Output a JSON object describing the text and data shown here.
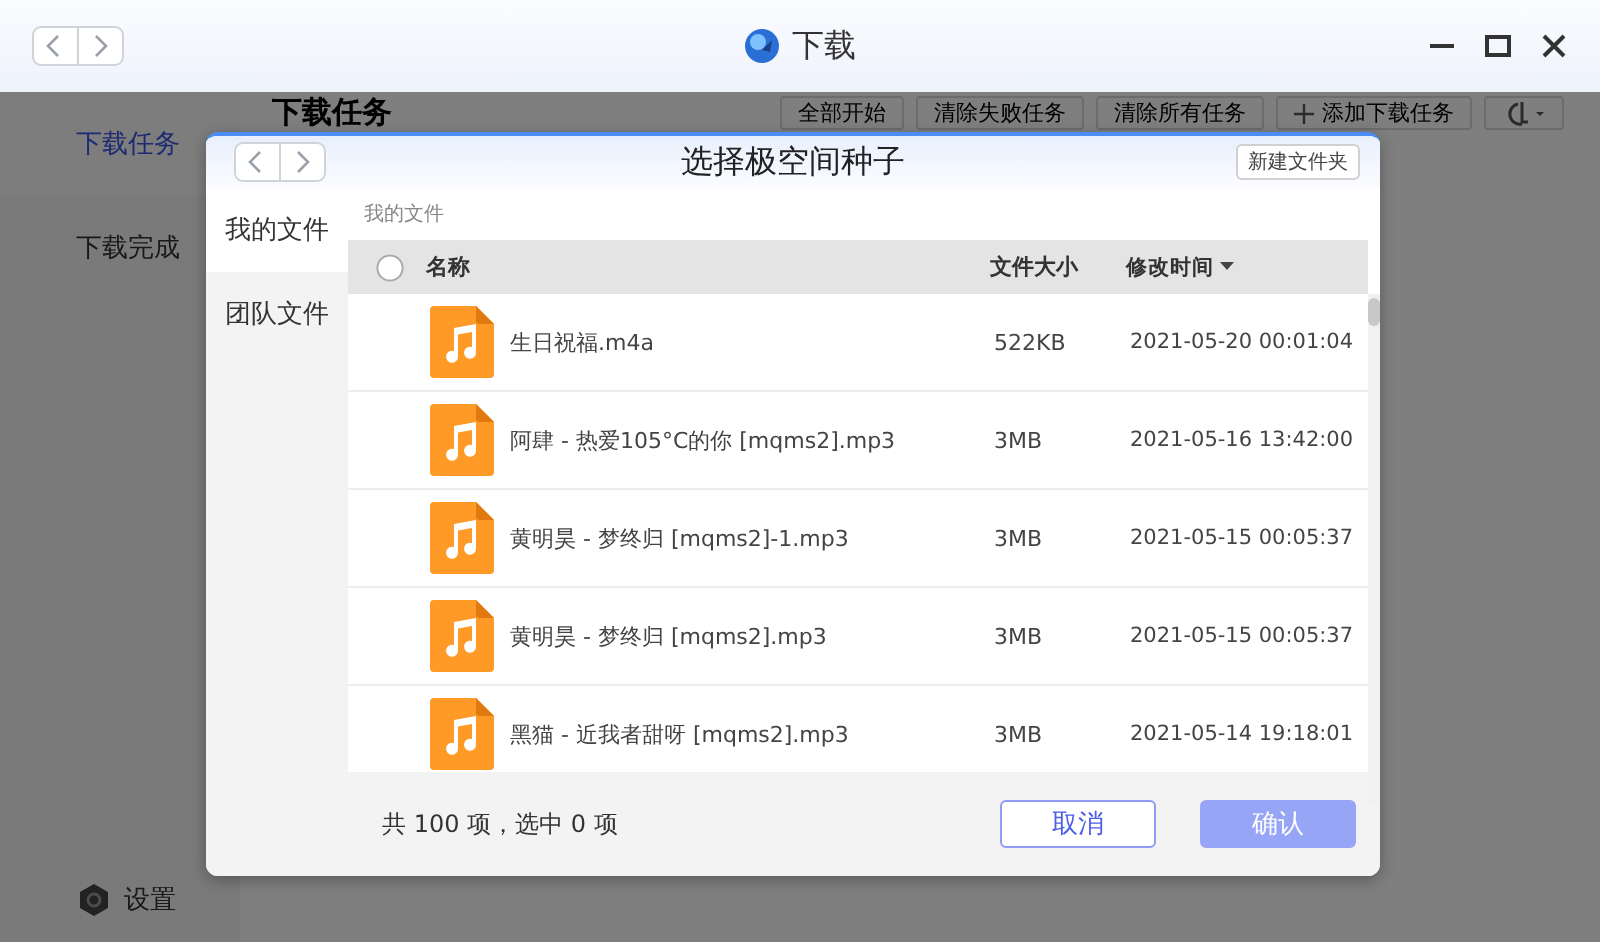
{
  "window": {
    "title": "下载"
  },
  "sidebar": {
    "items": [
      {
        "label": "下载任务",
        "selected": true
      },
      {
        "label": "下载完成",
        "selected": false
      }
    ],
    "settings": "设置"
  },
  "main": {
    "heading": "下载任务",
    "toolbar": [
      "全部开始",
      "清除失败任务",
      "清除所有任务"
    ],
    "add_button": "添加下载任务"
  },
  "dialog": {
    "title": "选择极空间种子",
    "new_folder": "新建文件夹",
    "tabs": [
      {
        "label": "我的文件",
        "selected": true
      },
      {
        "label": "团队文件",
        "selected": false
      }
    ],
    "breadcrumb": "我的文件",
    "select_all": {
      "checked": false
    },
    "columns": {
      "name": "名称",
      "size": "文件大小",
      "modified": "修改时间"
    },
    "rows": [
      {
        "name": "生日祝福.m4a",
        "size": "522KB",
        "modified": "2021-05-20 00:01:04"
      },
      {
        "name": "阿肆 - 热爱105°C的你 [mqms2].mp3",
        "size": "3MB",
        "modified": "2021-05-16 13:42:00"
      },
      {
        "name": "黄明昊 - 梦终归 [mqms2]-1.mp3",
        "size": "3MB",
        "modified": "2021-05-15 00:05:37"
      },
      {
        "name": "黄明昊 - 梦终归 [mqms2].mp3",
        "size": "3MB",
        "modified": "2021-05-15 00:05:37"
      },
      {
        "name": "黑猫 - 近我者甜呀 [mqms2].mp3",
        "size": "3MB",
        "modified": "2021-05-14 19:18:01"
      }
    ],
    "summary": "共 100 项，选中 0 项",
    "cancel": {
      "label": "取消",
      "disabled": false
    },
    "confirm": {
      "label": "确认",
      "disabled": true
    }
  }
}
